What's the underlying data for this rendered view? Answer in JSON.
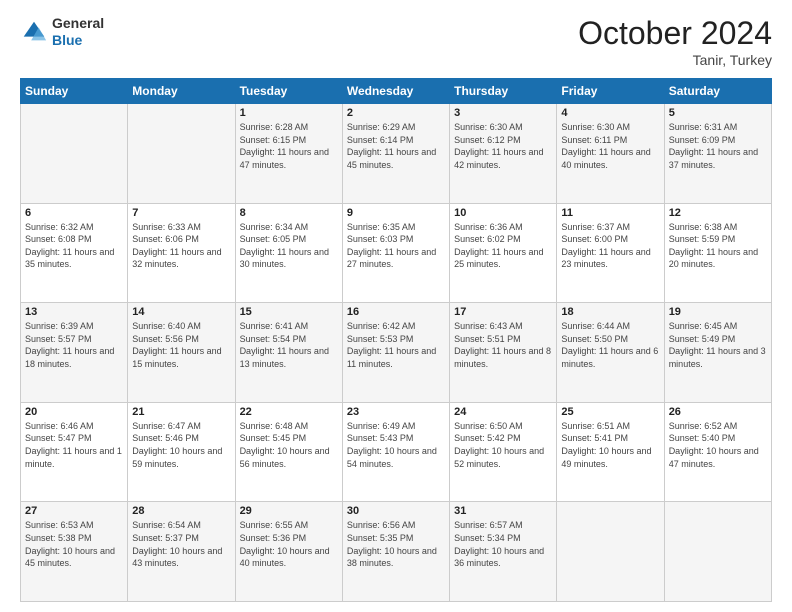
{
  "logo": {
    "general": "General",
    "blue": "Blue"
  },
  "header": {
    "month": "October 2024",
    "location": "Tanir, Turkey"
  },
  "weekdays": [
    "Sunday",
    "Monday",
    "Tuesday",
    "Wednesday",
    "Thursday",
    "Friday",
    "Saturday"
  ],
  "weeks": [
    [
      {
        "day": "",
        "info": ""
      },
      {
        "day": "",
        "info": ""
      },
      {
        "day": "1",
        "sunrise": "Sunrise: 6:28 AM",
        "sunset": "Sunset: 6:15 PM",
        "daylight": "Daylight: 11 hours and 47 minutes."
      },
      {
        "day": "2",
        "sunrise": "Sunrise: 6:29 AM",
        "sunset": "Sunset: 6:14 PM",
        "daylight": "Daylight: 11 hours and 45 minutes."
      },
      {
        "day": "3",
        "sunrise": "Sunrise: 6:30 AM",
        "sunset": "Sunset: 6:12 PM",
        "daylight": "Daylight: 11 hours and 42 minutes."
      },
      {
        "day": "4",
        "sunrise": "Sunrise: 6:30 AM",
        "sunset": "Sunset: 6:11 PM",
        "daylight": "Daylight: 11 hours and 40 minutes."
      },
      {
        "day": "5",
        "sunrise": "Sunrise: 6:31 AM",
        "sunset": "Sunset: 6:09 PM",
        "daylight": "Daylight: 11 hours and 37 minutes."
      }
    ],
    [
      {
        "day": "6",
        "sunrise": "Sunrise: 6:32 AM",
        "sunset": "Sunset: 6:08 PM",
        "daylight": "Daylight: 11 hours and 35 minutes."
      },
      {
        "day": "7",
        "sunrise": "Sunrise: 6:33 AM",
        "sunset": "Sunset: 6:06 PM",
        "daylight": "Daylight: 11 hours and 32 minutes."
      },
      {
        "day": "8",
        "sunrise": "Sunrise: 6:34 AM",
        "sunset": "Sunset: 6:05 PM",
        "daylight": "Daylight: 11 hours and 30 minutes."
      },
      {
        "day": "9",
        "sunrise": "Sunrise: 6:35 AM",
        "sunset": "Sunset: 6:03 PM",
        "daylight": "Daylight: 11 hours and 27 minutes."
      },
      {
        "day": "10",
        "sunrise": "Sunrise: 6:36 AM",
        "sunset": "Sunset: 6:02 PM",
        "daylight": "Daylight: 11 hours and 25 minutes."
      },
      {
        "day": "11",
        "sunrise": "Sunrise: 6:37 AM",
        "sunset": "Sunset: 6:00 PM",
        "daylight": "Daylight: 11 hours and 23 minutes."
      },
      {
        "day": "12",
        "sunrise": "Sunrise: 6:38 AM",
        "sunset": "Sunset: 5:59 PM",
        "daylight": "Daylight: 11 hours and 20 minutes."
      }
    ],
    [
      {
        "day": "13",
        "sunrise": "Sunrise: 6:39 AM",
        "sunset": "Sunset: 5:57 PM",
        "daylight": "Daylight: 11 hours and 18 minutes."
      },
      {
        "day": "14",
        "sunrise": "Sunrise: 6:40 AM",
        "sunset": "Sunset: 5:56 PM",
        "daylight": "Daylight: 11 hours and 15 minutes."
      },
      {
        "day": "15",
        "sunrise": "Sunrise: 6:41 AM",
        "sunset": "Sunset: 5:54 PM",
        "daylight": "Daylight: 11 hours and 13 minutes."
      },
      {
        "day": "16",
        "sunrise": "Sunrise: 6:42 AM",
        "sunset": "Sunset: 5:53 PM",
        "daylight": "Daylight: 11 hours and 11 minutes."
      },
      {
        "day": "17",
        "sunrise": "Sunrise: 6:43 AM",
        "sunset": "Sunset: 5:51 PM",
        "daylight": "Daylight: 11 hours and 8 minutes."
      },
      {
        "day": "18",
        "sunrise": "Sunrise: 6:44 AM",
        "sunset": "Sunset: 5:50 PM",
        "daylight": "Daylight: 11 hours and 6 minutes."
      },
      {
        "day": "19",
        "sunrise": "Sunrise: 6:45 AM",
        "sunset": "Sunset: 5:49 PM",
        "daylight": "Daylight: 11 hours and 3 minutes."
      }
    ],
    [
      {
        "day": "20",
        "sunrise": "Sunrise: 6:46 AM",
        "sunset": "Sunset: 5:47 PM",
        "daylight": "Daylight: 11 hours and 1 minute."
      },
      {
        "day": "21",
        "sunrise": "Sunrise: 6:47 AM",
        "sunset": "Sunset: 5:46 PM",
        "daylight": "Daylight: 10 hours and 59 minutes."
      },
      {
        "day": "22",
        "sunrise": "Sunrise: 6:48 AM",
        "sunset": "Sunset: 5:45 PM",
        "daylight": "Daylight: 10 hours and 56 minutes."
      },
      {
        "day": "23",
        "sunrise": "Sunrise: 6:49 AM",
        "sunset": "Sunset: 5:43 PM",
        "daylight": "Daylight: 10 hours and 54 minutes."
      },
      {
        "day": "24",
        "sunrise": "Sunrise: 6:50 AM",
        "sunset": "Sunset: 5:42 PM",
        "daylight": "Daylight: 10 hours and 52 minutes."
      },
      {
        "day": "25",
        "sunrise": "Sunrise: 6:51 AM",
        "sunset": "Sunset: 5:41 PM",
        "daylight": "Daylight: 10 hours and 49 minutes."
      },
      {
        "day": "26",
        "sunrise": "Sunrise: 6:52 AM",
        "sunset": "Sunset: 5:40 PM",
        "daylight": "Daylight: 10 hours and 47 minutes."
      }
    ],
    [
      {
        "day": "27",
        "sunrise": "Sunrise: 6:53 AM",
        "sunset": "Sunset: 5:38 PM",
        "daylight": "Daylight: 10 hours and 45 minutes."
      },
      {
        "day": "28",
        "sunrise": "Sunrise: 6:54 AM",
        "sunset": "Sunset: 5:37 PM",
        "daylight": "Daylight: 10 hours and 43 minutes."
      },
      {
        "day": "29",
        "sunrise": "Sunrise: 6:55 AM",
        "sunset": "Sunset: 5:36 PM",
        "daylight": "Daylight: 10 hours and 40 minutes."
      },
      {
        "day": "30",
        "sunrise": "Sunrise: 6:56 AM",
        "sunset": "Sunset: 5:35 PM",
        "daylight": "Daylight: 10 hours and 38 minutes."
      },
      {
        "day": "31",
        "sunrise": "Sunrise: 6:57 AM",
        "sunset": "Sunset: 5:34 PM",
        "daylight": "Daylight: 10 hours and 36 minutes."
      },
      {
        "day": "",
        "info": ""
      },
      {
        "day": "",
        "info": ""
      }
    ]
  ]
}
